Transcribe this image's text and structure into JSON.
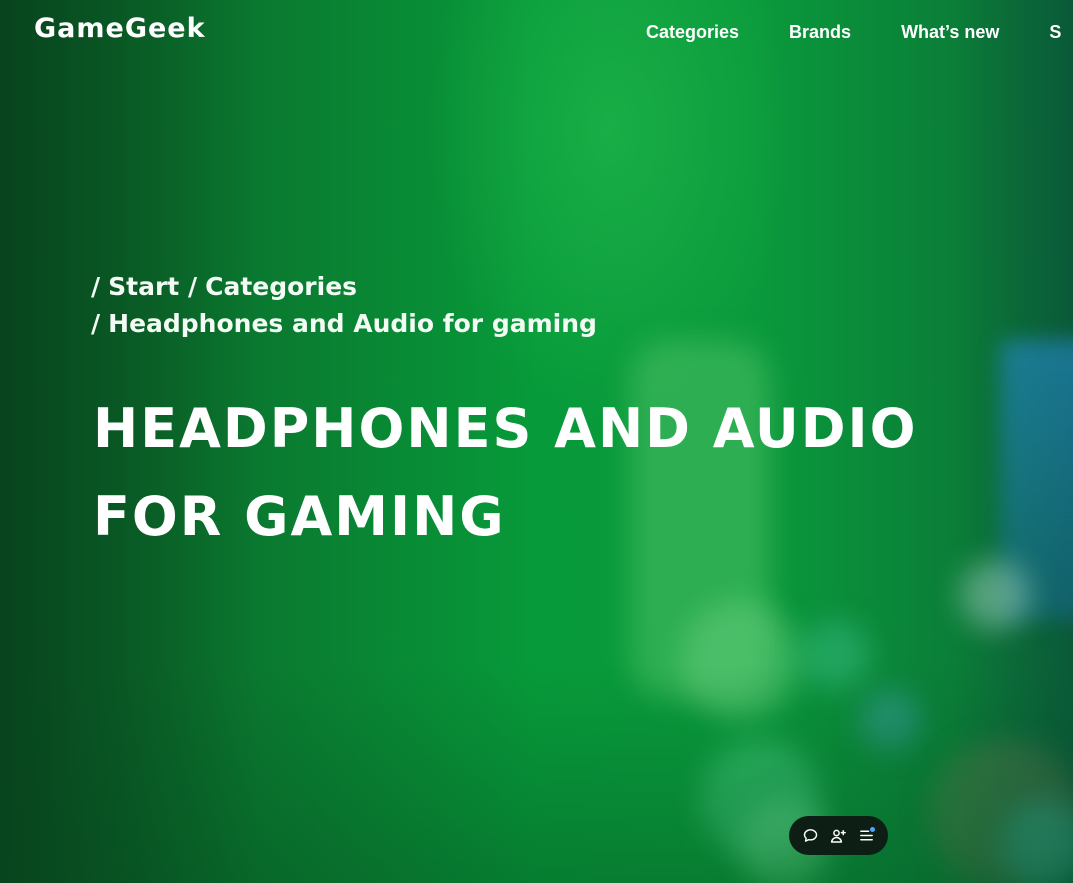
{
  "header": {
    "logo_text": "GameGeek",
    "nav": [
      {
        "label": "Categories"
      },
      {
        "label": "Brands"
      },
      {
        "label": "What’s new"
      },
      {
        "label": "S"
      }
    ]
  },
  "breadcrumb": {
    "separator": "/",
    "items": [
      {
        "label": "Start"
      },
      {
        "label": "Categories"
      },
      {
        "label": "Headphones and Audio for gaming"
      }
    ]
  },
  "page": {
    "title": "HEADPHONES AND AUDIO FOR GAMING"
  },
  "floating_toolbar": {
    "buttons": [
      {
        "icon": "chat-bubble-icon"
      },
      {
        "icon": "add-user-icon"
      },
      {
        "icon": "menu-icon"
      }
    ],
    "notification_dot_color": "#4aa3ff"
  },
  "colors": {
    "brand_green": "#079a3a",
    "text": "#ffffff",
    "toolbar_bg": "#0d1f14"
  }
}
